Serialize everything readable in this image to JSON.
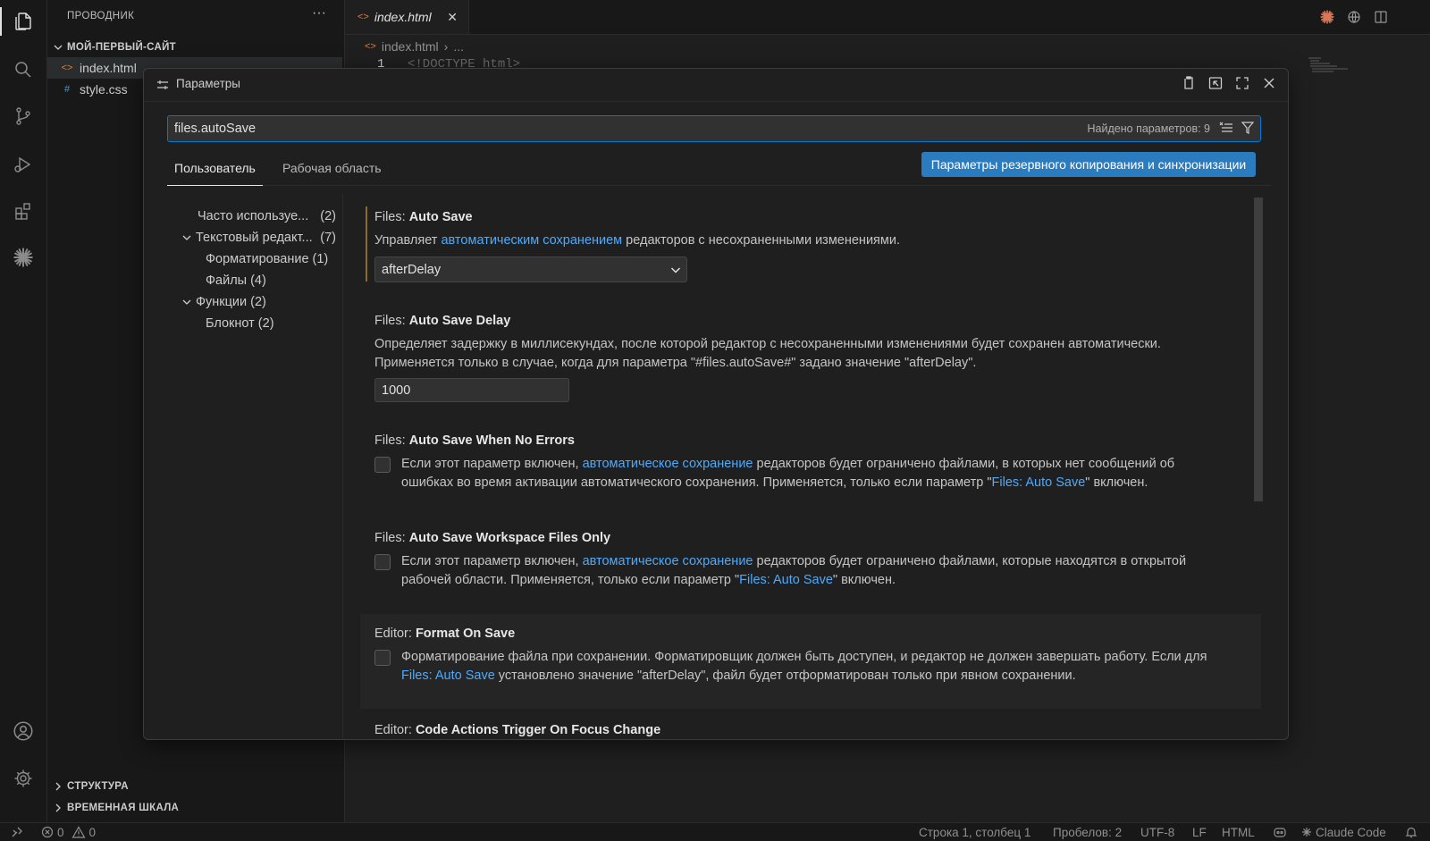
{
  "explorer": {
    "title": "ПРОВОДНИК",
    "more": "···",
    "folder": "МОЙ-ПЕРВЫЙ-САЙТ",
    "files": [
      {
        "name": "index.html",
        "icon": "<>"
      },
      {
        "name": "style.css",
        "icon": "#"
      }
    ],
    "outline": "СТРУКТУРА",
    "timeline": "ВРЕМЕННАЯ ШКАЛА"
  },
  "editor": {
    "tab": {
      "name": "index.html",
      "icon": "<>"
    },
    "breadcrumb": {
      "file": "index.html",
      "sep": "›",
      "more": "..."
    },
    "line_number": "1",
    "code": "<!DOCTYPE html>"
  },
  "settings": {
    "title": "Параметры",
    "search": {
      "value": "files.autoSave",
      "count": "Найдено параметров: 9"
    },
    "tabs": [
      "Пользователь",
      "Рабочая область"
    ],
    "sync_button": "Параметры резервного копирования и синхронизации",
    "toc": [
      {
        "label": "Часто используе...",
        "count": "(2)"
      },
      {
        "label": "Текстовый редакт...",
        "count": "(7)"
      },
      {
        "label": "Форматирование (1)",
        "count": ""
      },
      {
        "label": "Файлы (4)",
        "count": ""
      },
      {
        "label": "Функции (2)",
        "count": ""
      },
      {
        "label": "Блокнот (2)",
        "count": ""
      }
    ],
    "items": [
      {
        "category": "Files:",
        "name": "Auto Save",
        "desc_pre": "Управляет ",
        "desc_link": "автоматическим сохранением",
        "desc_post": " редакторов с несохраненными изменениями.",
        "value": "afterDelay"
      },
      {
        "category": "Files:",
        "name": "Auto Save Delay",
        "desc": "Определяет задержку в миллисекундах, после которой редактор с несохраненными изменениями будет сохранен автоматически. Применяется только в случае, когда для параметра \"#files.autoSave#\" задано значение \"afterDelay\".",
        "value": "1000"
      },
      {
        "category": "Files:",
        "name": "Auto Save When No Errors",
        "desc_pre": "Если этот параметр включен, ",
        "desc_link": "автоматическое сохранение",
        "desc_mid": " редакторов будет ограничено файлами, в которых нет сообщений об ошибках во время активации автоматического сохранения. Применяется, только если параметр \"",
        "desc_link2": "Files: Auto Save",
        "desc_post": "\" включен."
      },
      {
        "category": "Files:",
        "name": "Auto Save Workspace Files Only",
        "desc_pre": "Если этот параметр включен, ",
        "desc_link": "автоматическое сохранение",
        "desc_mid": " редакторов будет ограничено файлами, которые находятся в открытой рабочей области. Применяется, только если параметр \"",
        "desc_link2": "Files: Auto Save",
        "desc_post": "\" включен."
      },
      {
        "category": "Editor:",
        "name": "Format On Save",
        "desc_pre": "Форматирование файла при сохранении. Форматировщик должен быть доступен, и редактор не должен завершать работу. Если для ",
        "desc_link": "Files: Auto Save",
        "desc_post": " установлено значение \"afterDelay\", файл будет отформатирован только при явном сохранении."
      },
      {
        "category": "Editor:",
        "name": "Code Actions Trigger On Focus Change"
      }
    ]
  },
  "statusbar": {
    "errors": "0",
    "warnings": "0",
    "position": "Строка 1, столбец 1",
    "spaces": "Пробелов: 2",
    "encoding": "UTF-8",
    "eol": "LF",
    "language": "HTML",
    "claude": "Claude Code"
  },
  "colors": {
    "accent": "#0078d4",
    "link": "#4daafc",
    "button": "#2b7cbf",
    "modified": "#8a6b27",
    "claude": "#d97757"
  }
}
